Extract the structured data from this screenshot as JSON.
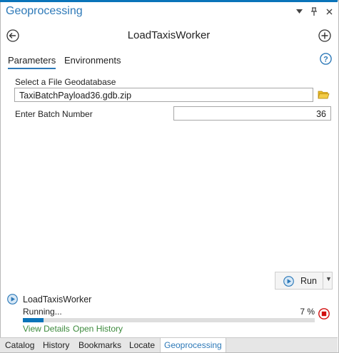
{
  "pane": {
    "title": "Geoprocessing",
    "header_icons": [
      "dropdown-icon",
      "pin-icon",
      "close-icon"
    ]
  },
  "tool": {
    "name": "LoadTaxisWorker",
    "nav_icons": [
      "back-arrow-icon",
      "add-icon"
    ]
  },
  "tabs": [
    {
      "label": "Parameters",
      "active": true
    },
    {
      "label": "Environments",
      "active": false
    }
  ],
  "params": {
    "gdb_label": "Select a File Geodatabase",
    "gdb_value": "TaxiBatchPayload36.gdb.zip",
    "batch_label": "Enter Batch Number",
    "batch_value": "36"
  },
  "run": {
    "label": "Run"
  },
  "job": {
    "name": "LoadTaxisWorker",
    "status": "Running...",
    "progress_text": "7 %",
    "progress": 0.07,
    "view_details": "View Details",
    "open_history": "Open History"
  },
  "bottom_tabs": [
    "Catalog",
    "History",
    "Bookmarks",
    "Locate",
    "Geoprocessing"
  ],
  "colors": {
    "accent": "#2d79b8",
    "progress": "#0a74b9",
    "link": "#3c8a3c",
    "stop": "#d20f0f"
  }
}
